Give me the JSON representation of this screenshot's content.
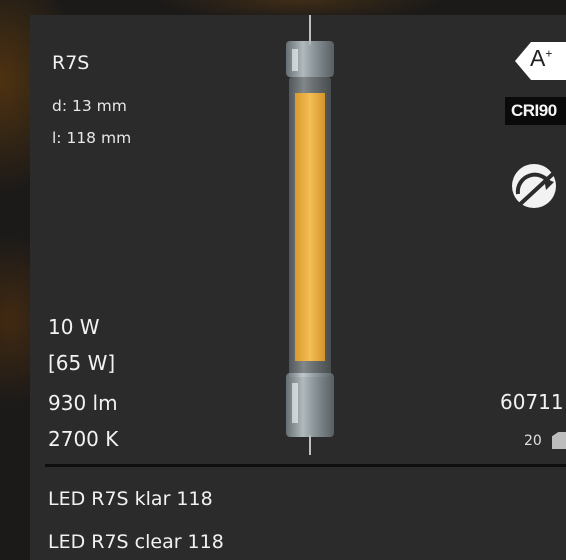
{
  "product": {
    "code": "R7S",
    "diameter": "d: 13 mm",
    "length": "l:  118 mm"
  },
  "specs": {
    "power": "10 W",
    "equivalent": "[65 W]",
    "lumen": "930 lm",
    "color_temp": "2700 K"
  },
  "names": {
    "de": "LED R7S klar 118",
    "en": "LED R7S clear 118"
  },
  "side": {
    "energy_class": "A",
    "energy_sup": "+",
    "cri": "CRI90",
    "article_no": "60711",
    "pack_qty": "20"
  },
  "icons": [
    "energy-label-icon",
    "cri-badge-icon",
    "not-dimmable-icon",
    "box-icon"
  ],
  "colors": {
    "panel": "#2b2b2b",
    "filament": "#efb44a",
    "text": "#f2f2f2"
  }
}
